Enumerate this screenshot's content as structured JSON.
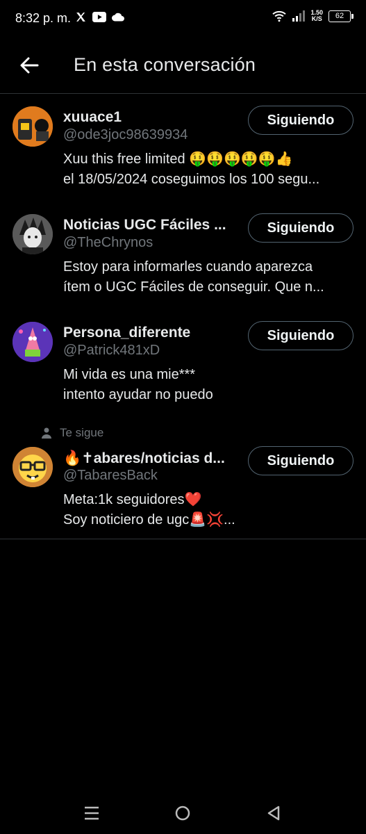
{
  "status_bar": {
    "time": "8:32 p. m.",
    "net_speed_value": "1.50",
    "net_speed_unit": "K/S",
    "battery": "62"
  },
  "header": {
    "title": "En esta conversación"
  },
  "users": [
    {
      "name": "xuuace1",
      "handle": "@ode3joc98639934",
      "button": "Siguiendo",
      "bio": [
        "Xuu this free limited 🤑🤑🤑🤑🤑👍",
        "el 18/05/2024 coseguimos los 100 segu..."
      ]
    },
    {
      "name": "Noticias UGC Fáciles ...",
      "handle": "@TheChrynos",
      "button": "Siguiendo",
      "bio": [
        "Estoy para informarles cuando aparezca",
        "ítem o UGC Fáciles de conseguir. Que n..."
      ]
    },
    {
      "name": "Persona_diferente",
      "handle": "@Patrick481xD",
      "button": "Siguiendo",
      "bio": [
        "Mi vida es una mie***",
        "intento ayudar no puedo"
      ]
    },
    {
      "follows_you_label": "Te sigue",
      "name": "🔥✝abares/noticias d...",
      "handle": "@TabaresBack",
      "button": "Siguiendo",
      "bio": [
        "Meta:1k seguidores❤️",
        "Soy noticiero de ugc🚨💢..."
      ]
    }
  ],
  "colors": {
    "background": "#000000",
    "text_primary": "#e7e9ea",
    "text_secondary": "#71767b",
    "border": "#2f3336"
  }
}
